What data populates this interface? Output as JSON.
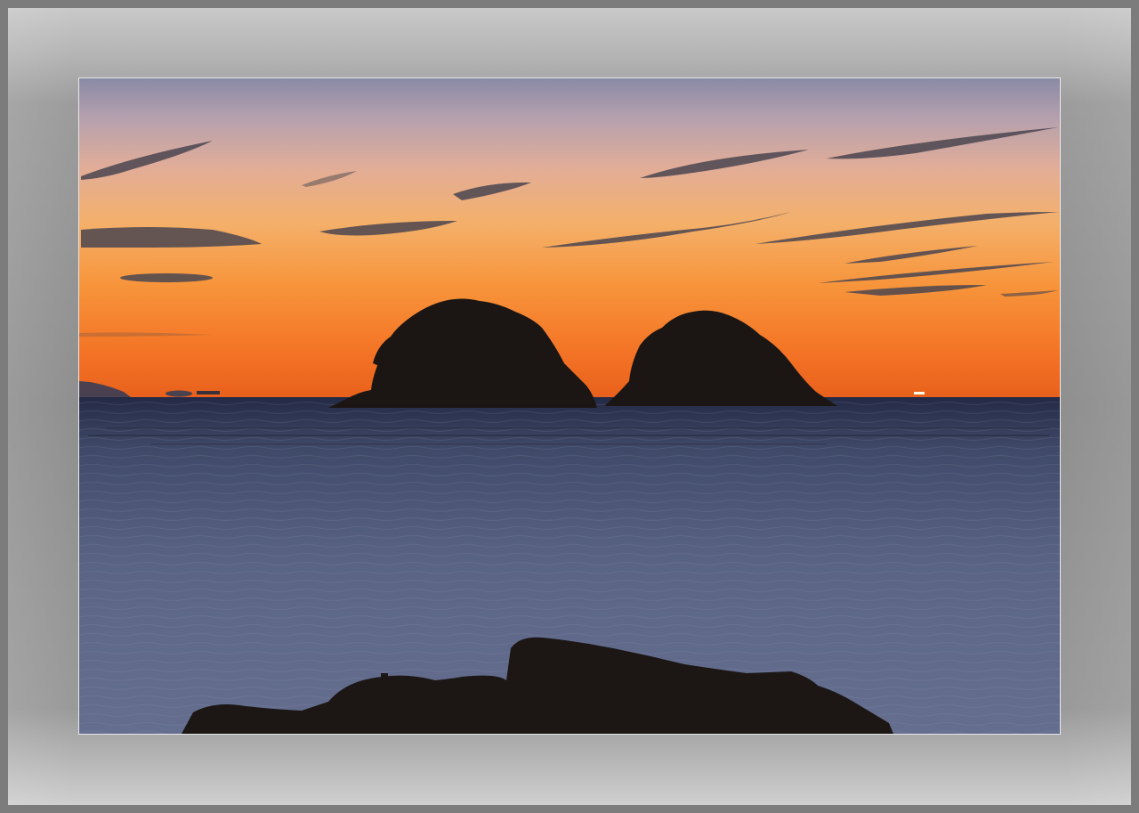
{
  "photo": {
    "subject": "sunset-over-sea-with-two-islands"
  },
  "colors": {
    "frame_light": "#cfcfcf",
    "frame_dark": "#8a8a8a",
    "sky_top": "#7f7f96",
    "sky_mid": "#f0a55a",
    "sky_horizon": "#f36b22",
    "sea_far": "#2b3350",
    "sea_near": "#556080",
    "silhouette": "#1b1714"
  }
}
